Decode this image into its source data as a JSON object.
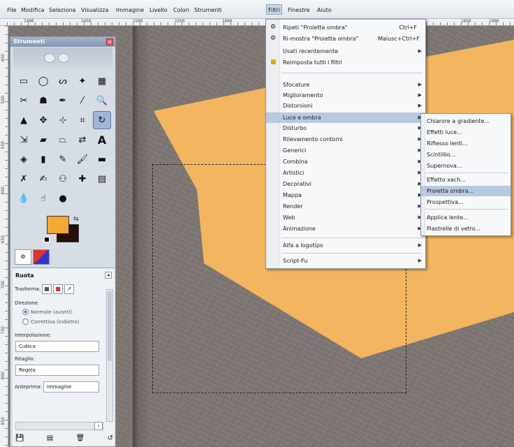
{
  "menubar": {
    "items": [
      "File",
      "Modifica",
      "Seleziona",
      "Visualizza",
      "Immagine",
      "Livello",
      "Colori",
      "Strumenti",
      "Filtri",
      "Finestre",
      "Aiuto"
    ],
    "active": "Filtri"
  },
  "ruler": {
    "ticks": [
      "1400",
      "1450",
      "1500",
      "1550",
      "1600",
      "1850",
      "1900"
    ],
    "vticks": [
      "450",
      "500",
      "550",
      "600",
      "650",
      "700",
      "750",
      "800",
      "850"
    ]
  },
  "toolbox": {
    "title": "Strumenti",
    "colors": {
      "foreground": "#f2a935",
      "background": "#2a0d0a"
    },
    "options": {
      "title": "Ruota",
      "transform_label": "Trasforma:",
      "direction_label": "Direzione",
      "direction_options": [
        "Normale (avanti)",
        "Correttiva (indietro)"
      ],
      "interpolation_label": "Interpolazione:",
      "interpolation_value": "Cubica",
      "clipping_label": "Ritaglio:",
      "clipping_value": "Regola",
      "preview_label": "Anteprima:",
      "preview_value": "Immagine"
    }
  },
  "filters_menu": {
    "items": [
      {
        "label": "Ripeti \"Proietta ombra\"",
        "shortcut": "Ctrl+F",
        "icon": "repeat-icon"
      },
      {
        "label": "Ri-mostra \"Proietta ombra\"",
        "shortcut": "Maiusc+Ctrl+F",
        "icon": "reshow-icon"
      },
      {
        "label": "Usati recentemente",
        "submenu": true
      },
      {
        "label": "Reimposta tutti i filtri",
        "icon": "reset-icon"
      },
      {
        "label": "Sfocature",
        "submenu": true
      },
      {
        "label": "Miglioramento",
        "submenu": true
      },
      {
        "label": "Distorsioni",
        "submenu": true
      },
      {
        "label": "Luce e ombra",
        "submenu": true,
        "highlight": true
      },
      {
        "label": "Disturbo",
        "submenu": true
      },
      {
        "label": "Rilevamento contorni",
        "submenu": true
      },
      {
        "label": "Generici",
        "submenu": true
      },
      {
        "label": "Combina",
        "submenu": true
      },
      {
        "label": "Artistici",
        "submenu": true
      },
      {
        "label": "Decorativi",
        "submenu": true
      },
      {
        "label": "Mappa",
        "submenu": true
      },
      {
        "label": "Render",
        "submenu": true
      },
      {
        "label": "Web",
        "submenu": true
      },
      {
        "label": "Animazione",
        "submenu": true
      },
      {
        "label": "Alfa a logotipo",
        "submenu": true
      },
      {
        "label": "Script-Fu",
        "submenu": true
      }
    ]
  },
  "light_shadow_menu": {
    "items": [
      {
        "label": "Chiarore a gradiente..."
      },
      {
        "label": "Effetti luce..."
      },
      {
        "label": "Riflesso lenti..."
      },
      {
        "label": "Scintillio..."
      },
      {
        "label": "Supernova..."
      },
      {
        "label": "Effetto xach..."
      },
      {
        "label": "Proietta ombra...",
        "highlight": true
      },
      {
        "label": "Prospettiva..."
      },
      {
        "label": "Applica lente..."
      },
      {
        "label": "Piastrelle di vetro..."
      }
    ]
  },
  "canvas": {
    "paper_color": "#f3b55f"
  }
}
